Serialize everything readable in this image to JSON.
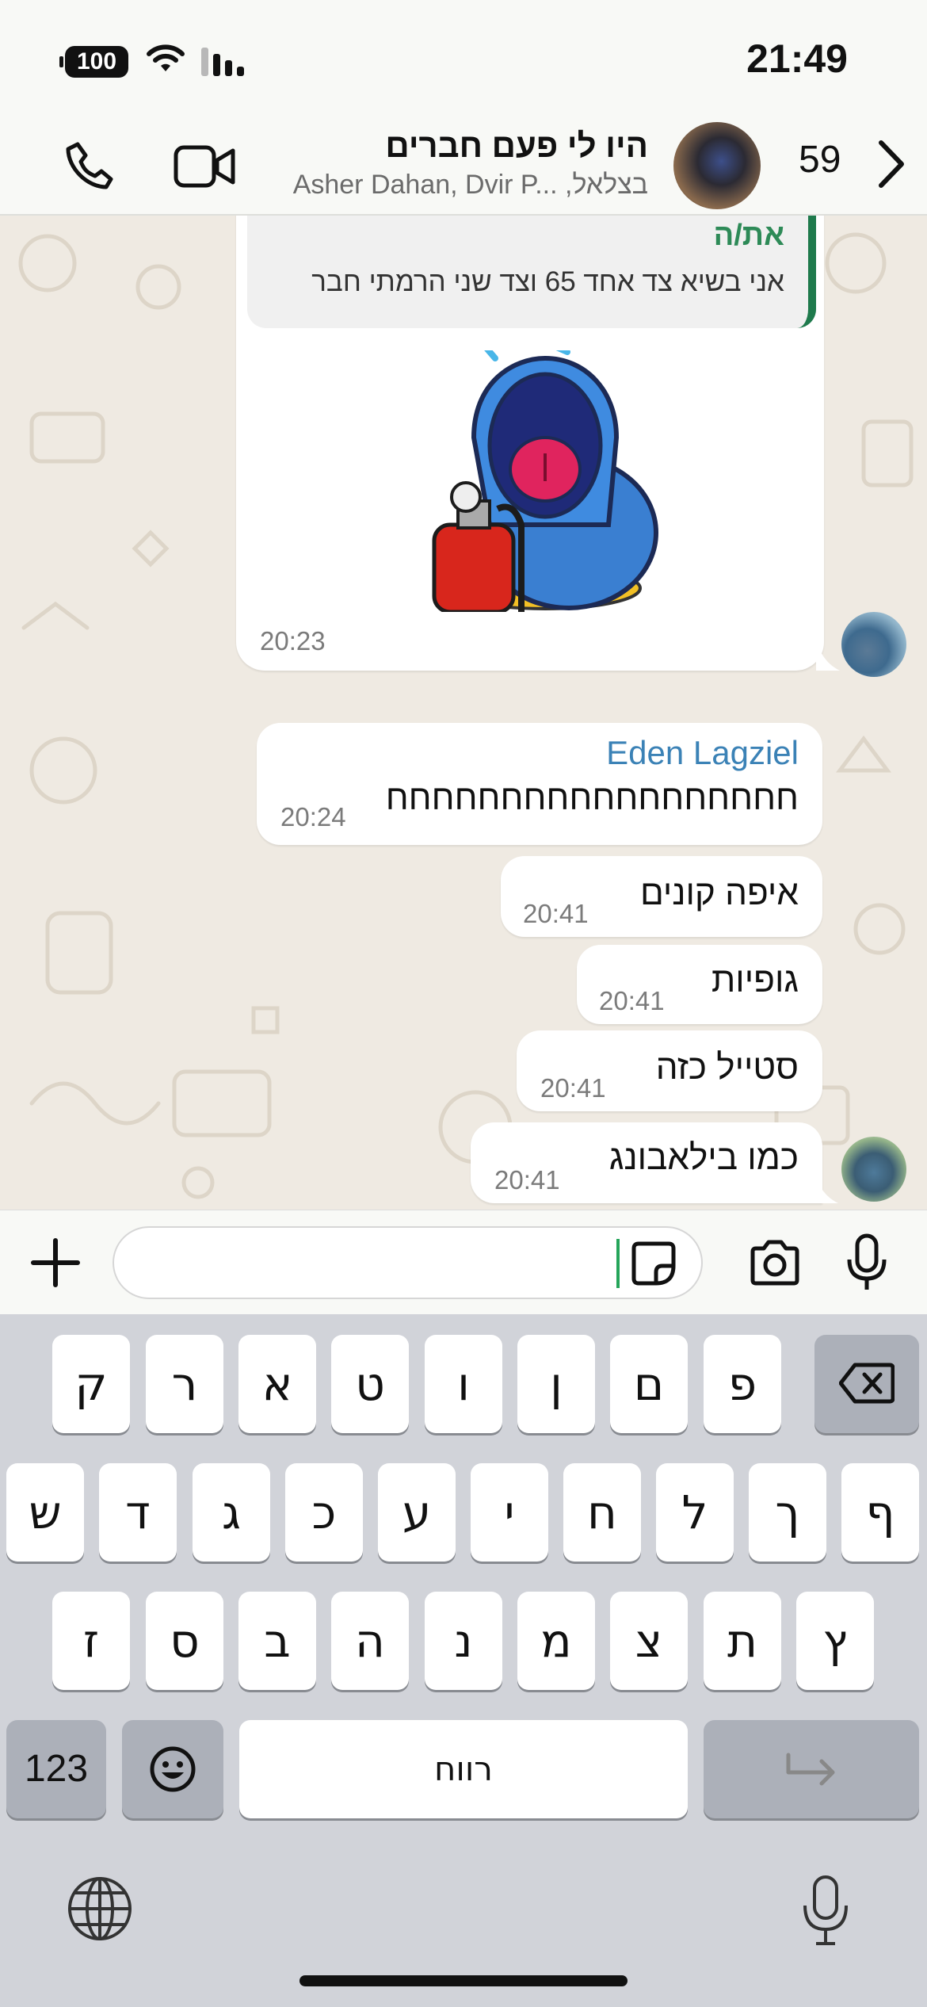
{
  "status_bar": {
    "battery": "100",
    "time": "21:49"
  },
  "header": {
    "title": "היו לי פעם חברים",
    "members": "Asher Dahan, Dvir P... ,בצלאל",
    "unread_count": "59"
  },
  "messages": {
    "quote": {
      "author": "את/ה",
      "text": "אני בשיא צד אחד 65 וצד שני הרמתי חבר"
    },
    "sticker_time": "20:23",
    "m1": {
      "sender": "Eden Lagziel",
      "text": "חחחחחחחחחחחחחחחחחח",
      "time": "20:24"
    },
    "m2": {
      "text": "איפה קונים",
      "time": "20:41"
    },
    "m3": {
      "text": "גופיות",
      "time": "20:41"
    },
    "m4": {
      "text": "סטייל כזה",
      "time": "20:41"
    },
    "m5": {
      "text": "כמו בילאבונג",
      "time": "20:41"
    }
  },
  "keyboard": {
    "row1": [
      "ק",
      "ר",
      "א",
      "ט",
      "ו",
      "ן",
      "ם",
      "פ"
    ],
    "row2": [
      "ש",
      "ד",
      "ג",
      "כ",
      "ע",
      "י",
      "ח",
      "ל",
      "ך",
      "ף"
    ],
    "row3": [
      "ז",
      "ס",
      "ב",
      "ה",
      "נ",
      "מ",
      "צ",
      "ת",
      "ץ"
    ],
    "numbers_label": "123",
    "space_label": "רווח"
  },
  "colors": {
    "accent": "#25a55a",
    "sender_blue": "#3b82b6",
    "quote_green": "#2d8a57"
  },
  "icons": [
    "phone-icon",
    "video-icon",
    "chevron-right-icon",
    "plus-icon",
    "sticker-icon",
    "camera-icon",
    "mic-icon",
    "backspace-icon",
    "emoji-icon",
    "return-icon",
    "globe-icon",
    "dictation-icon",
    "wifi-icon",
    "signal-icon"
  ]
}
